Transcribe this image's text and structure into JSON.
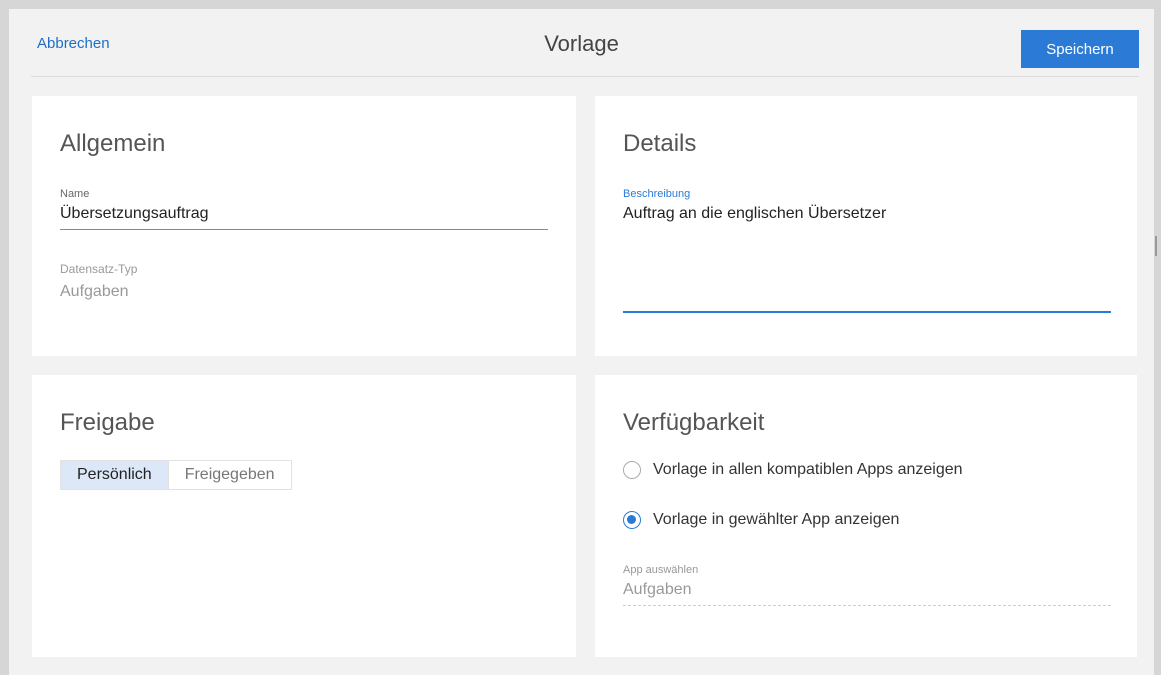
{
  "header": {
    "cancel_label": "Abbrechen",
    "title": "Vorlage",
    "save_label": "Speichern"
  },
  "general": {
    "title": "Allgemein",
    "name_label": "Name",
    "name_value": "Übersetzungsauftrag",
    "record_type_label": "Datensatz-Typ",
    "record_type_value": "Aufgaben"
  },
  "details": {
    "title": "Details",
    "description_label": "Beschreibung",
    "description_value": "Auftrag an die englischen Übersetzer"
  },
  "sharing": {
    "title": "Freigabe",
    "options": [
      "Persönlich",
      "Freigegeben"
    ],
    "selected": "Persönlich"
  },
  "availability": {
    "title": "Verfügbarkeit",
    "option_all": "Vorlage in allen kompatiblen Apps anzeigen",
    "option_selected": "Vorlage in gewählter App anzeigen",
    "selected_option": "Vorlage in gewählter App anzeigen",
    "app_label": "App auswählen",
    "app_value": "Aufgaben"
  },
  "colors": {
    "accent": "#2b7bd6",
    "link": "#1e6ec8",
    "background": "#f2f2f2",
    "card": "#ffffff",
    "segment_active": "#dce8f7"
  }
}
